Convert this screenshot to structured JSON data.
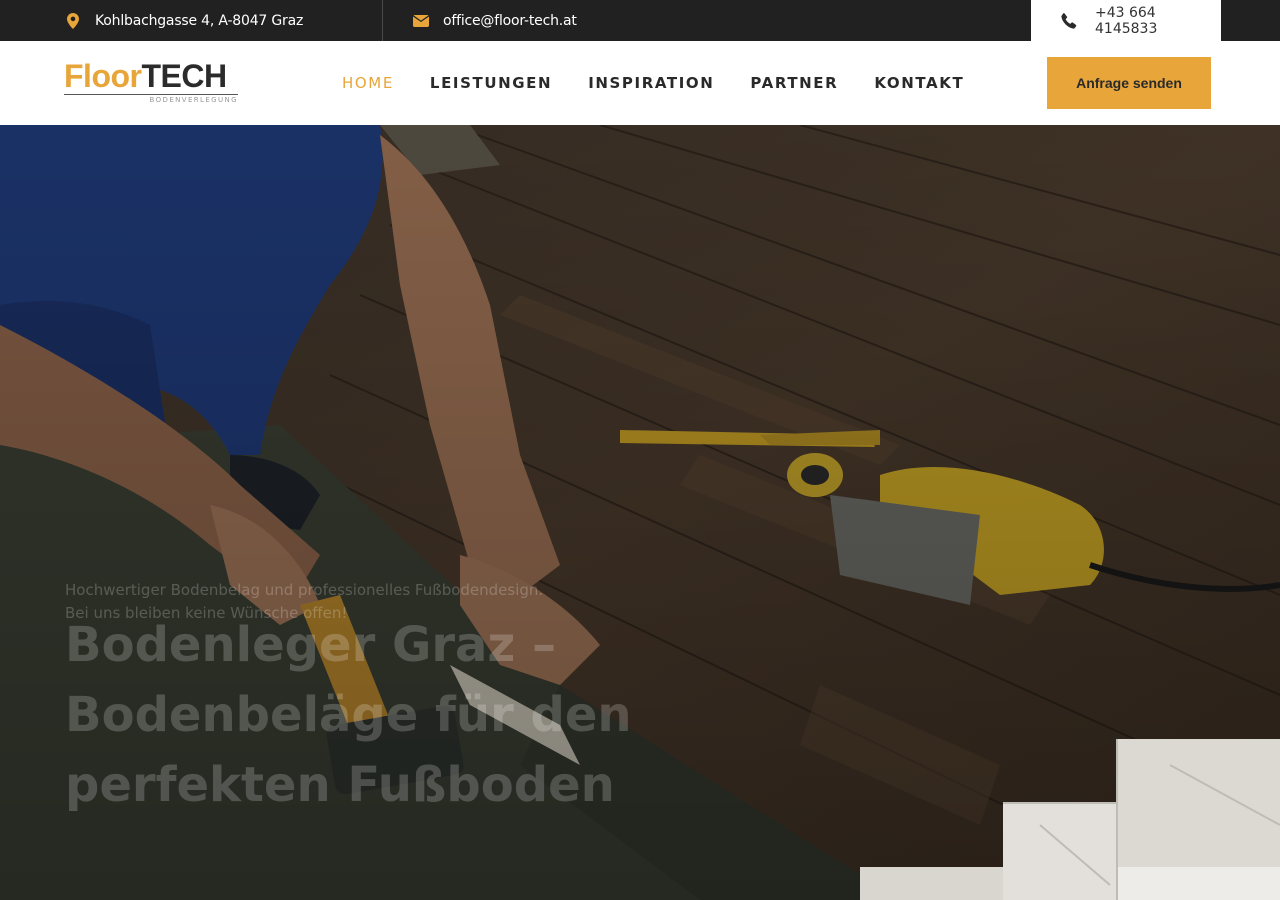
{
  "topbar": {
    "address": "Kohlbachgasse 4, A-8047 Graz",
    "address_icon": "map-marker-icon",
    "email": "office@floor-tech.at",
    "email_icon": "envelope-icon",
    "phone": "+43 664 4145833",
    "phone_icon": "phone-icon"
  },
  "logo": {
    "part1": "Floor",
    "part2": "TECH",
    "subtitle": "BODENVERLEGUNG"
  },
  "nav": {
    "items": [
      {
        "label": "HOME",
        "active": true
      },
      {
        "label": "LEISTUNGEN",
        "active": false
      },
      {
        "label": "INSPIRATION",
        "active": false
      },
      {
        "label": "PARTNER",
        "active": false
      },
      {
        "label": "KONTAKT",
        "active": false
      }
    ]
  },
  "cta": {
    "label": "Anfrage senden"
  },
  "hero": {
    "tagline": "Hochwertiger Bodenbelag und professionelles Fußbodendesign. Bei uns bleiben keine Wünsche offen!",
    "headline": "Bodenleger Graz – Bodenbeläge für den perfekten Fußboden"
  },
  "colors": {
    "accent": "#e8a53a",
    "topbar_bg": "#212121",
    "text_dark": "#2a2a2a"
  }
}
